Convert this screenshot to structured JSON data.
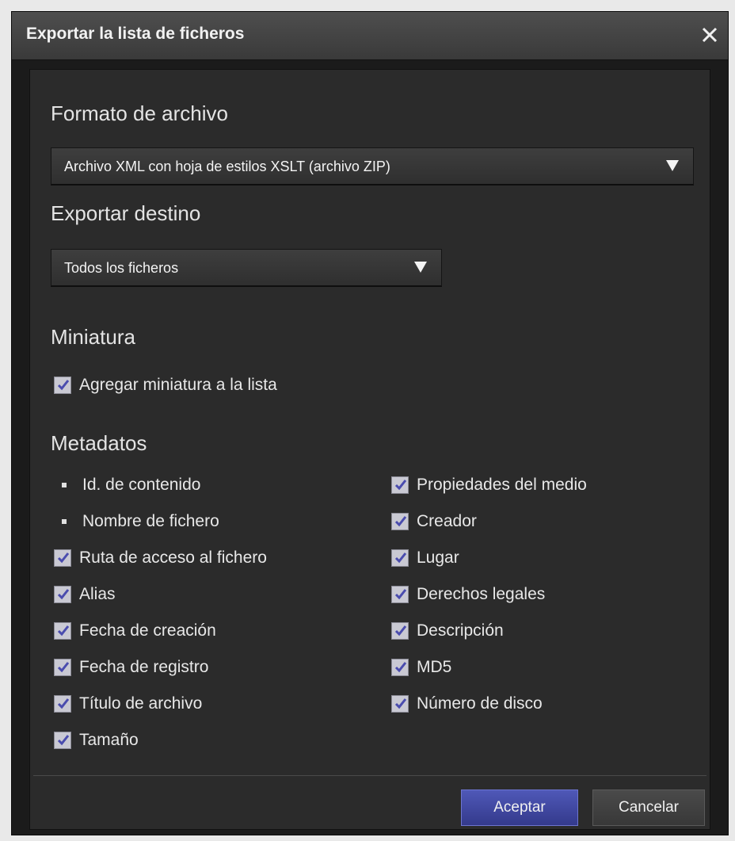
{
  "dialog": {
    "title": "Exportar la lista de ficheros",
    "close_icon": "close-icon"
  },
  "format": {
    "heading": "Formato de archivo",
    "selected": "Archivo XML con hoja de estilos XSLT (archivo ZIP)"
  },
  "destination": {
    "heading": "Exportar destino",
    "selected": "Todos los ficheros"
  },
  "thumbnail": {
    "heading": "Miniatura",
    "add_label": "Agregar miniatura a la lista",
    "add_checked": true
  },
  "metadata": {
    "heading": "Metadatos",
    "left": [
      {
        "label": "Id. de contenido",
        "type": "fixed"
      },
      {
        "label": "Nombre de fichero",
        "type": "fixed"
      },
      {
        "label": "Ruta de acceso al fichero",
        "type": "checkbox",
        "checked": true
      },
      {
        "label": "Alias",
        "type": "checkbox",
        "checked": true
      },
      {
        "label": "Fecha de creación",
        "type": "checkbox",
        "checked": true
      },
      {
        "label": "Fecha de registro",
        "type": "checkbox",
        "checked": true
      },
      {
        "label": "Título de archivo",
        "type": "checkbox",
        "checked": true
      },
      {
        "label": "Tamaño",
        "type": "checkbox",
        "checked": true
      }
    ],
    "right": [
      {
        "label": "Propiedades del medio",
        "type": "checkbox",
        "checked": true
      },
      {
        "label": "Creador",
        "type": "checkbox",
        "checked": true
      },
      {
        "label": "Lugar",
        "type": "checkbox",
        "checked": true
      },
      {
        "label": "Derechos legales",
        "type": "checkbox",
        "checked": true
      },
      {
        "label": "Descripción",
        "type": "checkbox",
        "checked": true
      },
      {
        "label": "MD5",
        "type": "checkbox",
        "checked": true
      },
      {
        "label": "Número de disco",
        "type": "checkbox",
        "checked": true
      }
    ]
  },
  "buttons": {
    "accept": "Aceptar",
    "cancel": "Cancelar"
  },
  "colors": {
    "primary_button": "#4a52b0",
    "background": "#2b2b2b"
  }
}
